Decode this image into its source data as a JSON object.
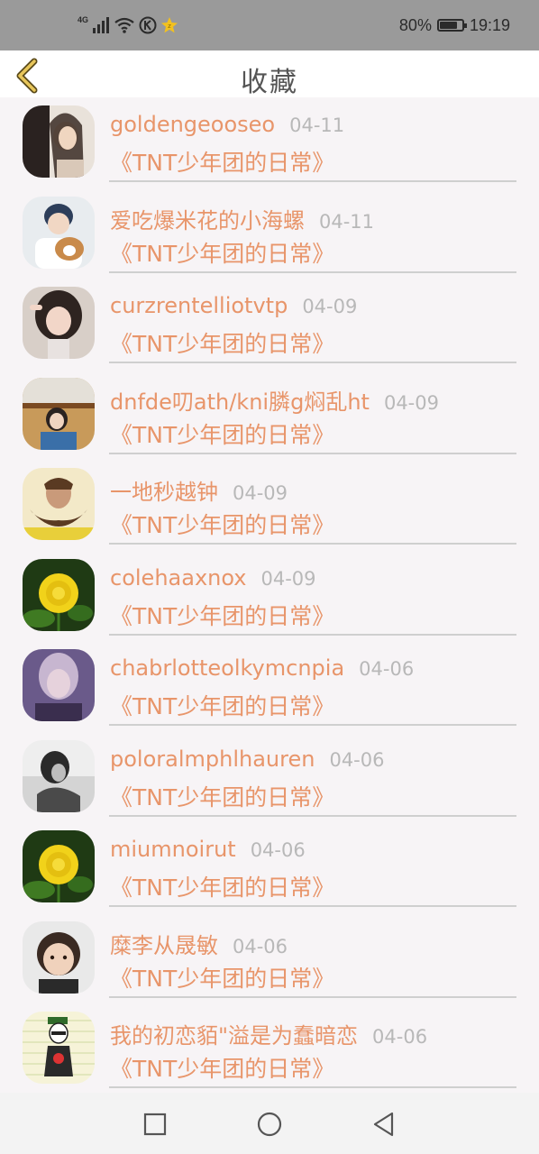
{
  "status_bar": {
    "network_label": "4G",
    "battery_text": "80%",
    "battery_level": 0.8,
    "time": "19:19",
    "icons": [
      "signal-icon",
      "wifi-icon",
      "k-icon",
      "star-badge-icon",
      "battery-icon"
    ]
  },
  "header": {
    "title": "收藏",
    "back_icon": "chevron-left-icon",
    "accent_color": "#c9a44a"
  },
  "colors": {
    "name_text": "#e8956a",
    "date_text": "#b8b8b8",
    "divider": "#cfcfcf"
  },
  "items": [
    {
      "name": "goldengeooseo",
      "date": "04-11",
      "title": "《TNT少年团的日常》"
    },
    {
      "name": "爱吃爆米花的小海螺",
      "date": "04-11",
      "title": "《TNT少年团的日常》"
    },
    {
      "name": "curzrentelliotvtp",
      "date": "04-09",
      "title": "《TNT少年团的日常》"
    },
    {
      "name": "dnfde叨ath/kni膦g焖乱ht",
      "date": "04-09",
      "title": "《TNT少年团的日常》"
    },
    {
      "name": "一地秒越钟",
      "date": "04-09",
      "title": "《TNT少年团的日常》"
    },
    {
      "name": "colehaaxnox",
      "date": "04-09",
      "title": "《TNT少年团的日常》"
    },
    {
      "name": "chabrlotteolkymcnpia",
      "date": "04-06",
      "title": "《TNT少年团的日常》"
    },
    {
      "name": "poloralmphlhauren",
      "date": "04-06",
      "title": "《TNT少年团的日常》"
    },
    {
      "name": "miumnoirut",
      "date": "04-06",
      "title": "《TNT少年团的日常》"
    },
    {
      "name": "糜李从晟敏",
      "date": "04-06",
      "title": "《TNT少年团的日常》"
    },
    {
      "name": "我的初恋貊\"溢是为蠢暗恋",
      "date": "04-06",
      "title": "《TNT少年团的日常》"
    }
  ],
  "nav_bar": {
    "icons": [
      "recents-square-icon",
      "home-circle-icon",
      "back-triangle-icon"
    ]
  }
}
